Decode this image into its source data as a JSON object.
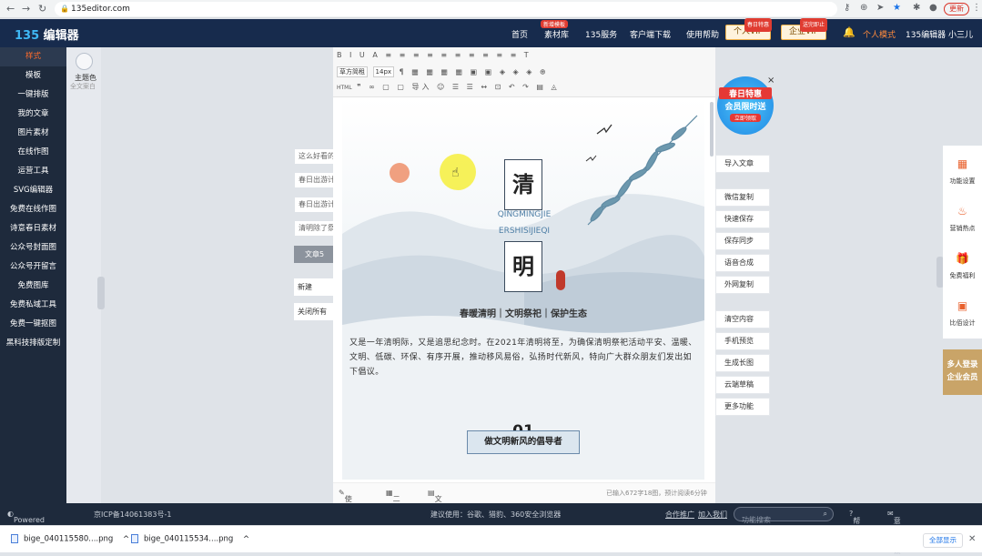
{
  "browser": {
    "url": "135editor.com",
    "update_label": "更新",
    "update_initial": "B"
  },
  "header": {
    "logo_num": "135",
    "logo_text": "编辑器",
    "nav": [
      {
        "label": "首页",
        "badge": ""
      },
      {
        "label": "素材库",
        "badge": "新增模板"
      },
      {
        "label": "135服务",
        "badge": ""
      },
      {
        "label": "客户端下载",
        "badge": ""
      },
      {
        "label": "使用帮助",
        "badge": ""
      }
    ],
    "vip_personal": {
      "label": "个人VIP",
      "badge": "春日特惠"
    },
    "vip_enterprise": {
      "label": "企业VIP",
      "badge": "送完即止"
    },
    "mode": "个人模式",
    "user": "135编辑器 小三儿"
  },
  "sidebar": {
    "items": [
      {
        "label": "样式",
        "active": true
      },
      {
        "label": "模板"
      },
      {
        "label": "一键排版"
      },
      {
        "label": "我的文章"
      },
      {
        "label": "图片素材"
      },
      {
        "label": "在线作图"
      },
      {
        "label": "运营工具"
      },
      {
        "label": "SVG编辑器"
      },
      {
        "label": "免费在线作图"
      },
      {
        "label": "诗意春日素材"
      },
      {
        "label": "公众号封面图"
      },
      {
        "label": "公众号开留言"
      },
      {
        "label": "免费图库"
      },
      {
        "label": "免费私域工具"
      },
      {
        "label": "免费一键抠图"
      },
      {
        "label": "黑科技排版定制"
      }
    ]
  },
  "theme": {
    "label": "主题色",
    "sub": "全文案白"
  },
  "doc_list": {
    "items": [
      "这么好看的",
      "春日出游计",
      "春日出游计",
      "清明除了祭"
    ],
    "active_doc": "文章5",
    "new_label": "新建",
    "close_all": "关闭所有"
  },
  "toolbar": {
    "font": "草方简租",
    "size": "14px",
    "html": "HTML",
    "row1": "B I U A ≡ ≡ ≡ ≡ ≡ ≡ ≡ ≡ ≡ ≡ T",
    "row2": "¶ ▦ ▦ ▦ ▦ ▣ ▣ ◈ ◈ ◈ ⊕",
    "row3": "❞ ∞ ▢ ▢ 导入 ☺ ☰ ☰ ↔ ⊡ ↶ ↷ ▤ ◬"
  },
  "article": {
    "char1": "清",
    "char2": "明",
    "pinyin1": "QINGMINGJIE",
    "pinyin2": "ERSHISIJIEQI",
    "subtitle": "春暖清明｜文明祭祀｜保护生态",
    "paragraph": "又是一年清明际，又是追思纪念时。在2021年清明将至，为确保清明祭祀活动平安、温暖、文明、低碳、环保、有序开展，推动移风易俗，弘扬时代新风，特向广大群众朋友们发出如下倡议。",
    "section_num": "01",
    "section_title": "做文明新风的倡导者"
  },
  "status": {
    "signature": "使用签名",
    "qrcode": "二维码",
    "proofread": "文章校对",
    "count": "已输入672字18图，预计阅读6分钟"
  },
  "ad": {
    "line1": "春日特惠",
    "line2": "会员限时送",
    "line3": "立即领取",
    "close": "×"
  },
  "actions": {
    "group1": [
      "导入文章"
    ],
    "group2": [
      "微信复制",
      "快速保存",
      "保存同步",
      "语音合成",
      "外网复制"
    ],
    "group3": [
      "清空内容",
      "手机预览",
      "生成长图",
      "云端草稿",
      "更多功能"
    ]
  },
  "right_panel": [
    {
      "label": "功能设置",
      "icon": "grid-icon"
    },
    {
      "label": "营销热点",
      "icon": "flame-icon"
    },
    {
      "label": "免费福利",
      "icon": "gift-icon"
    },
    {
      "label": "比佰设计",
      "icon": "image-icon"
    }
  ],
  "member_box": {
    "line1": "多人登录",
    "line2": "企业会员"
  },
  "footer": {
    "powered": "Powered By 135编辑器",
    "icp": "京ICP备14061383号-1",
    "browser_tip": "建议使用：谷歌、猎豹、360安全浏览器",
    "partner": "合作推广",
    "join": "加入我们",
    "search_placeholder": "功能搜索",
    "help": "帮助",
    "feedback": "意见反馈"
  },
  "downloads": {
    "files": [
      "bige_040115580....png",
      "bige_040115534....png"
    ],
    "show_all": "全部显示"
  }
}
